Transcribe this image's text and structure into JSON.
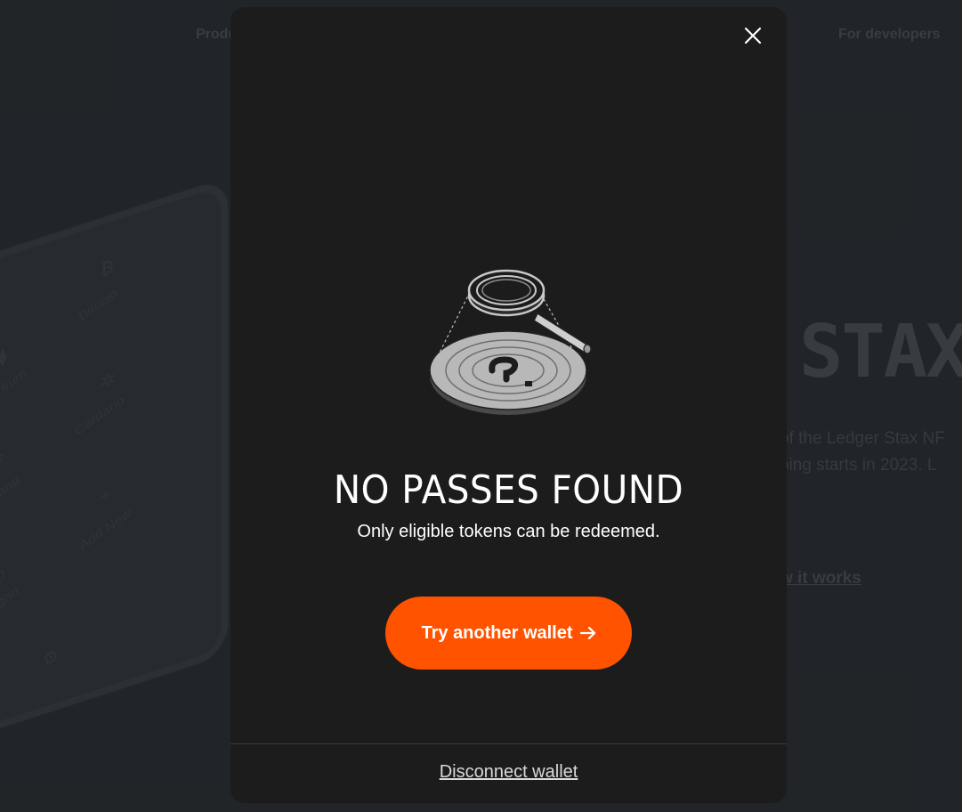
{
  "background": {
    "nav": {
      "product": "Produ",
      "developers": "For developers"
    },
    "hero": {
      "title": "STAX",
      "desc_line1": "of the Ledger Stax NF",
      "desc_line2": "ping starts in 2023. L",
      "link": "w it works"
    },
    "device": {
      "apps": [
        "Ethereum",
        "Bitcoin",
        "Solana",
        "Cardano",
        "Polygon",
        "Add New"
      ]
    }
  },
  "modal": {
    "title": "NO PASSES FOUND",
    "subtitle": "Only eligible tokens can be redeemed.",
    "cta_label": "Try another wallet",
    "footer_link": "Disconnect wallet",
    "icons": {
      "close": "close-icon",
      "arrow": "arrow-right-icon",
      "illustration": "magnifying-glass-coin-illustration"
    },
    "colors": {
      "accent": "#ff5300",
      "modal_bg": "#1c1c1c",
      "page_bg": "#24272b"
    }
  }
}
